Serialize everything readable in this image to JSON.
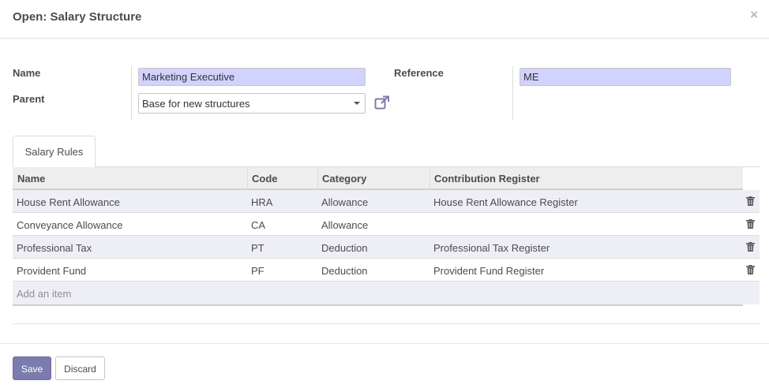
{
  "dialog": {
    "title": "Open: Salary Structure",
    "close_symbol": "×"
  },
  "form": {
    "name_label": "Name",
    "name_value": "Marketing Executive",
    "parent_label": "Parent",
    "parent_value": "Base for new structures",
    "reference_label": "Reference",
    "reference_value": "ME"
  },
  "tabs": [
    {
      "label": "Salary Rules"
    }
  ],
  "table": {
    "columns": [
      "Name",
      "Code",
      "Category",
      "Contribution Register"
    ],
    "rows": [
      {
        "name": "House Rent Allowance",
        "code": "HRA",
        "category": "Allowance",
        "register": "House Rent Allowance Register"
      },
      {
        "name": "Conveyance Allowance",
        "code": "CA",
        "category": "Allowance",
        "register": ""
      },
      {
        "name": "Professional Tax",
        "code": "PT",
        "category": "Deduction",
        "register": "Professional Tax Register"
      },
      {
        "name": "Provident Fund",
        "code": "PF",
        "category": "Deduction",
        "register": "Provident Fund Register"
      }
    ],
    "add_item_label": "Add an item",
    "row_action_icon": "trash-icon"
  },
  "footer": {
    "save_label": "Save",
    "discard_label": "Discard"
  },
  "colors": {
    "primary": "#7c7bad",
    "required_input_bg": "#d2d2ff",
    "row_stripe": "#eeeef7"
  }
}
